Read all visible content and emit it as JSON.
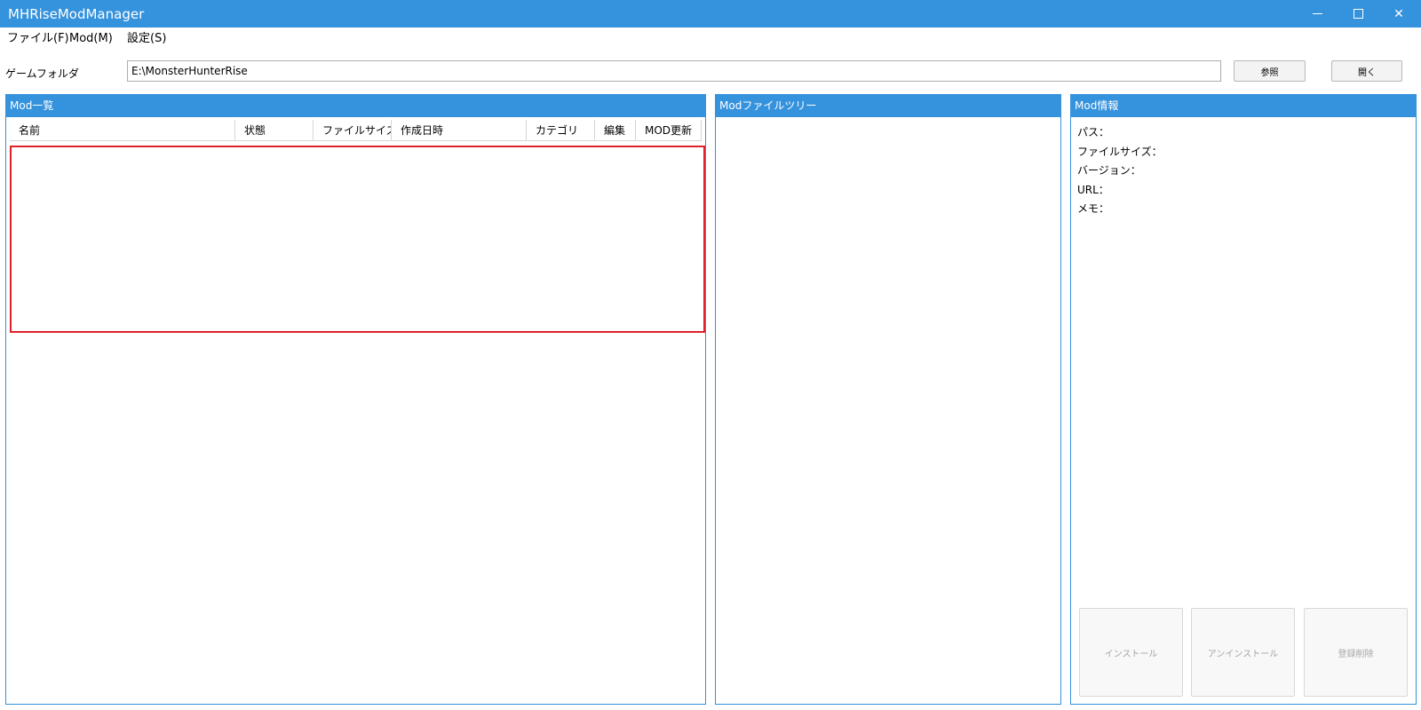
{
  "window": {
    "title": "MHRiseModManager",
    "minimize_icon": "minimize-icon",
    "maximize_icon": "maximize-icon",
    "close_icon": "close-icon",
    "close_glyph": "✕"
  },
  "menu": {
    "items": [
      {
        "label": "ファイル(F)"
      },
      {
        "label": "Mod(M)"
      },
      {
        "label": "設定(S)"
      }
    ]
  },
  "game_folder": {
    "label": "ゲームフォルダ",
    "value": "E:\\MonsterHunterRise",
    "browse_label": "参照",
    "open_label": "開く"
  },
  "mod_list": {
    "title": "Mod一覧",
    "columns": [
      "名前",
      "状態",
      "ファイルサイズ",
      "作成日時",
      "カテゴリ",
      "編集",
      "MOD更新"
    ]
  },
  "file_tree": {
    "title": "Modファイルツリー"
  },
  "mod_info": {
    "title": "Mod情報",
    "fields": [
      "パス：",
      "ファイルサイズ：",
      "バージョン：",
      "URL：",
      "メモ："
    ],
    "install_label": "インストール",
    "uninstall_label": "アンインストール",
    "remove_label": "登録削除"
  },
  "colors": {
    "accent": "#3592dd",
    "highlight_border": "#e0202a",
    "disabled_text": "#a5a5a5"
  }
}
